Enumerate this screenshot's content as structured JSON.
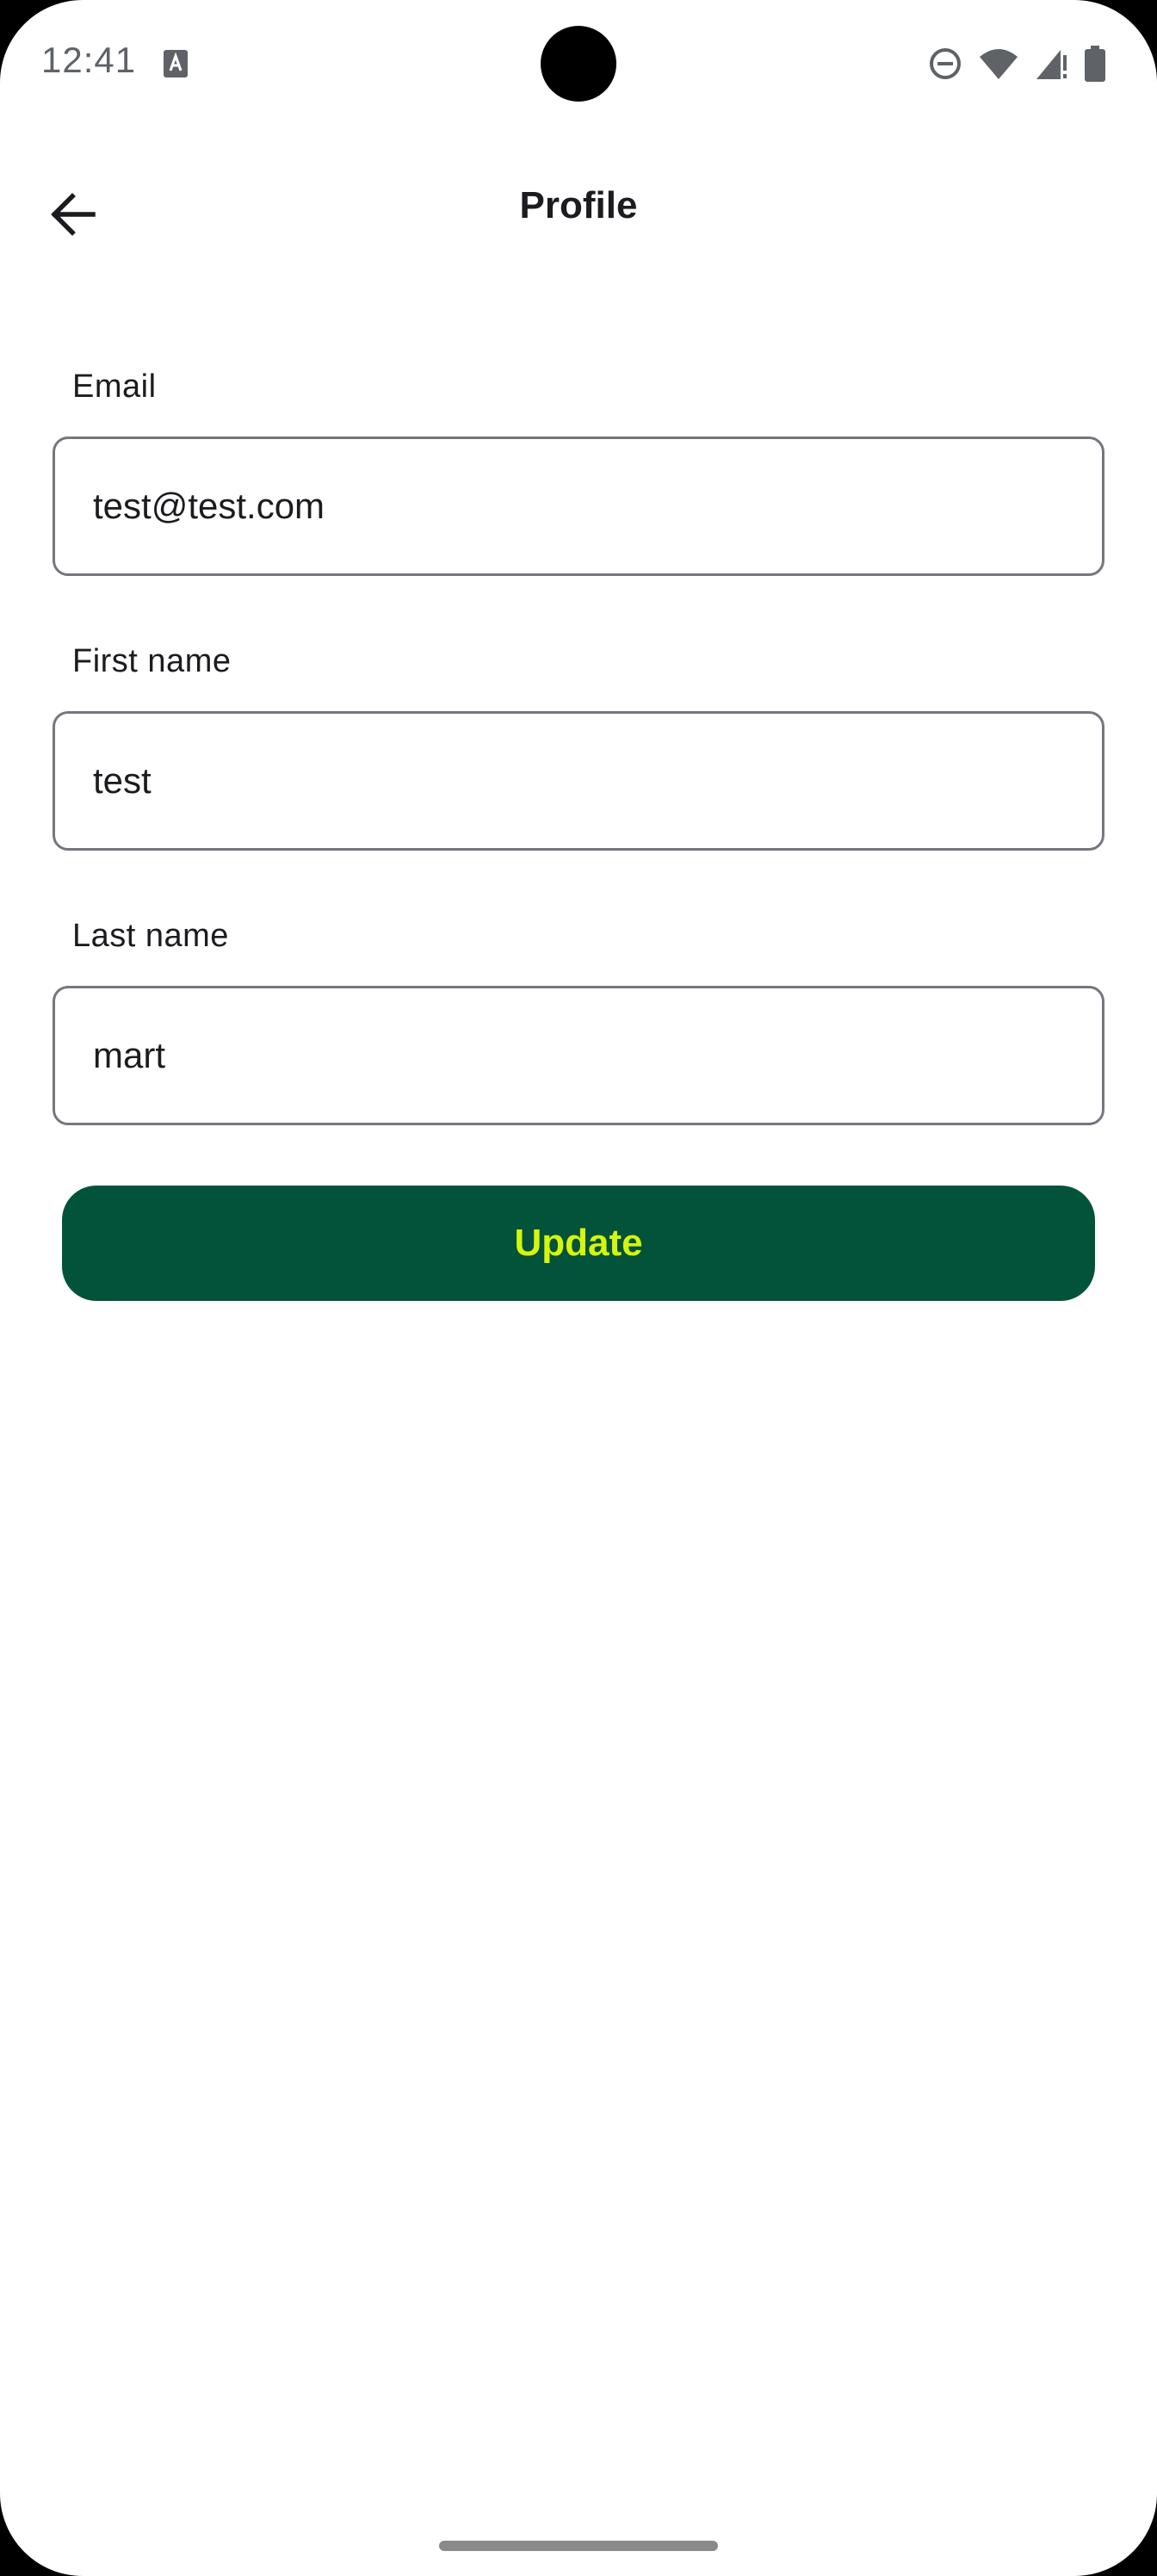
{
  "status_bar": {
    "time": "12:41",
    "icons": [
      "keyboard-a-icon",
      "do-not-disturb-icon",
      "wifi-icon",
      "cell-signal-icon",
      "battery-icon"
    ]
  },
  "top_bar": {
    "back_icon": "arrow-back-icon",
    "title": "Profile"
  },
  "form": {
    "email": {
      "label": "Email",
      "value": "test@test.com"
    },
    "first_name": {
      "label": "First name",
      "value": "test"
    },
    "last_name": {
      "label": "Last name",
      "value": "mart"
    }
  },
  "actions": {
    "update_label": "Update"
  },
  "colors": {
    "button_bg": "#02533a",
    "button_text": "#d6f40e",
    "field_border": "#79747e"
  }
}
